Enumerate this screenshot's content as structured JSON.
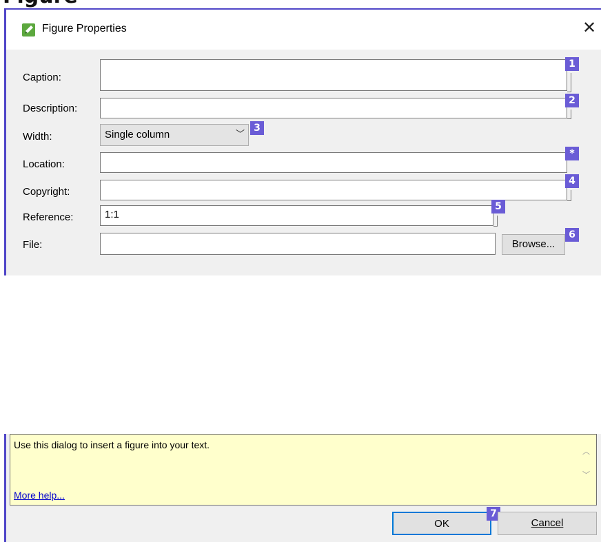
{
  "top_cut_text": "Figure",
  "dialog": {
    "title": "Figure Properties",
    "close_glyph": "✕",
    "icon": "pen-app-icon"
  },
  "fields": {
    "caption": {
      "label": "Caption:",
      "value": ""
    },
    "description": {
      "label": "Description:",
      "value": ""
    },
    "width": {
      "label": "Width:",
      "value": "Single column",
      "options": [
        "Single column"
      ]
    },
    "location": {
      "label": "Location:",
      "value": ""
    },
    "copyright": {
      "label": "Copyright:",
      "value": ""
    },
    "reference": {
      "label": "Reference:",
      "value": "1:1"
    },
    "file": {
      "label": "File:",
      "value": ""
    }
  },
  "buttons": {
    "browse": "Browse...",
    "ok": "OK",
    "cancel": "Cancel"
  },
  "help": {
    "text": "Use this dialog to insert a figure into your text.",
    "link": "More help..."
  },
  "badges": [
    "1",
    "2",
    "3",
    "*",
    "4",
    "5",
    "6",
    "7"
  ],
  "colors": {
    "badge": "#6a5cd6",
    "dialog_border": "#5046c8",
    "help_background": "#ffffcc",
    "link": "#0000cc",
    "ok_border": "#0078d7"
  }
}
